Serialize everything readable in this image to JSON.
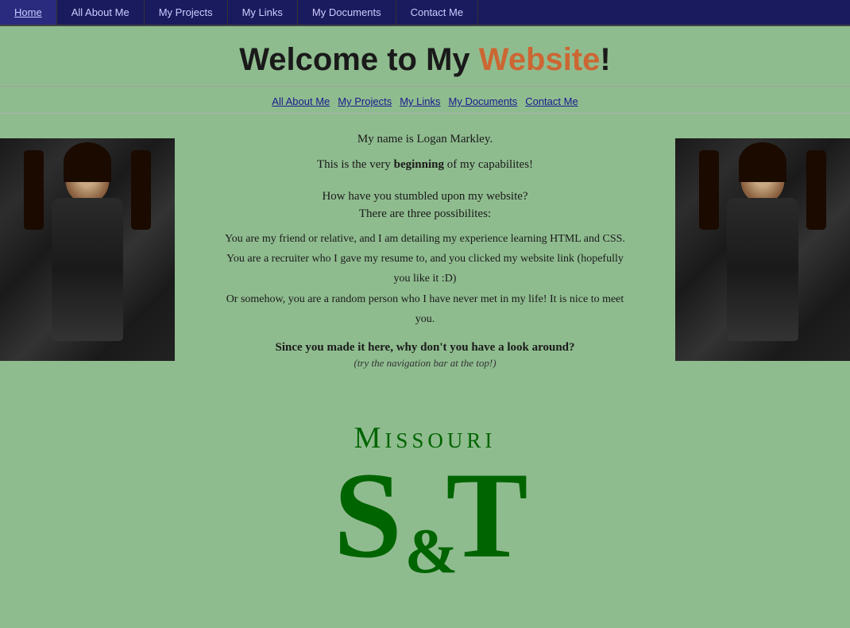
{
  "navbar": {
    "items": [
      {
        "label": "Home",
        "id": "nav-home"
      },
      {
        "label": "All About Me",
        "id": "nav-about"
      },
      {
        "label": "My Projects",
        "id": "nav-projects"
      },
      {
        "label": "My Links",
        "id": "nav-links"
      },
      {
        "label": "My Documents",
        "id": "nav-documents"
      },
      {
        "label": "Contact Me",
        "id": "nav-contact"
      }
    ]
  },
  "header": {
    "welcome_prefix": "Welcome to My ",
    "welcome_highlight": "Website",
    "welcome_suffix": "!"
  },
  "secondary_nav": {
    "items": [
      {
        "label": "All About Me"
      },
      {
        "label": "My Projects"
      },
      {
        "label": "My Links"
      },
      {
        "label": "My Documents"
      },
      {
        "label": "Contact Me"
      }
    ]
  },
  "content": {
    "intro_line1": "My name is Logan Markley.",
    "intro_line2_prefix": "This is the very ",
    "intro_line2_bold": "beginning",
    "intro_line2_suffix": " of my capabilites!",
    "question_line1": "How have you stumbled upon my website?",
    "question_line2_prefix": "There are ",
    "question_line2_italic": "three",
    "question_line2_suffix": " possibilites:",
    "list_item1": "You are my friend or relative, and I am detailing my experience learning HTML and CSS.",
    "list_item2": "You are a recruiter who I gave my resume to, and you clicked my website link (hopefully you like it :D)",
    "list_item3": "Or somehow, you are a random person who I have never met in my life! It is nice to meet you.",
    "cta_bold": "Since you made it here, why don't you have a look around?",
    "cta_hint": "(try the navigation bar at the top!)"
  },
  "logo": {
    "missouri": "Missouri",
    "st": "S&T"
  },
  "colors": {
    "background": "#8fbc8f",
    "navbar_bg": "#1a1a5e",
    "nav_text": "#ccccff",
    "highlight_orange": "#cc6633",
    "logo_green": "#006400",
    "link_blue": "#1a1a8e",
    "text_dark": "#1a1a1a"
  }
}
